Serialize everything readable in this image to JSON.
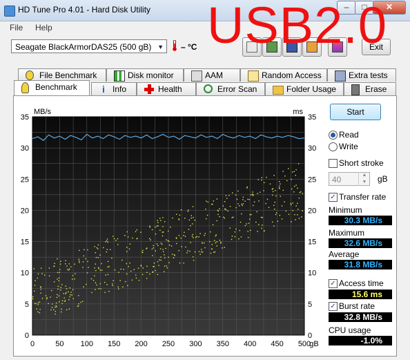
{
  "window": {
    "title": "HD Tune Pro 4.01 - Hard Disk Utility",
    "exit_label": "Exit"
  },
  "watermark": "USB2.0",
  "menu": [
    {
      "label": "File"
    },
    {
      "label": "Help"
    }
  ],
  "toolbar": {
    "drive": "Seagate BlackArmorDAS25  (500 gB)",
    "temperature": "– °C"
  },
  "tabs_top": [
    {
      "label": "File Benchmark",
      "icon": "file-benchmark-icon"
    },
    {
      "label": "Disk monitor",
      "icon": "disk-monitor-icon"
    },
    {
      "label": "AAM",
      "icon": "speaker-icon"
    },
    {
      "label": "Random Access",
      "icon": "random-access-icon"
    },
    {
      "label": "Extra tests",
      "icon": "extra-tests-icon"
    }
  ],
  "tabs_bottom": [
    {
      "label": "Benchmark",
      "icon": "benchmark-icon",
      "active": true
    },
    {
      "label": "Info",
      "icon": "info-icon"
    },
    {
      "label": "Health",
      "icon": "health-icon"
    },
    {
      "label": "Error Scan",
      "icon": "magnifier-icon"
    },
    {
      "label": "Folder Usage",
      "icon": "folder-icon"
    },
    {
      "label": "Erase",
      "icon": "trash-icon"
    }
  ],
  "controls": {
    "start_label": "Start",
    "read_label": "Read",
    "write_label": "Write",
    "mode_selected": "Read",
    "short_stroke_label": "Short stroke",
    "short_stroke_checked": false,
    "short_stroke_value": "40",
    "short_stroke_unit": "gB",
    "transfer_rate_label": "Transfer rate",
    "transfer_rate_checked": true,
    "access_time_label": "Access time",
    "access_time_checked": true,
    "burst_rate_label": "Burst rate",
    "burst_rate_checked": true
  },
  "stats": {
    "minimum_label": "Minimum",
    "minimum": "30.3 MB/s",
    "maximum_label": "Maximum",
    "maximum": "32.6 MB/s",
    "average_label": "Average",
    "average": "31.8 MB/s",
    "access_time": "15.6 ms",
    "burst_rate": "32.8 MB/s",
    "cpu_label": "CPU usage",
    "cpu_usage": "-1.0%"
  },
  "chart_data": {
    "type": "line",
    "ylabel_left": "MB/s",
    "ylabel_right": "ms",
    "xunit": "gB",
    "xlim": [
      0,
      500
    ],
    "ylim": [
      0,
      35
    ],
    "x_ticks": [
      "0",
      "50",
      "100",
      "150",
      "200",
      "250",
      "300",
      "350",
      "400",
      "450",
      "500"
    ],
    "y_ticks": [
      "0",
      "5",
      "10",
      "15",
      "20",
      "25",
      "30",
      "35"
    ],
    "grid": true,
    "series": [
      {
        "color": "#5aa9e6",
        "x": [
          0,
          10,
          20,
          30,
          40,
          50,
          60,
          70,
          80,
          90,
          100,
          110,
          120,
          130,
          140,
          150,
          160,
          170,
          180,
          190,
          200,
          210,
          220,
          230,
          240,
          250,
          260,
          270,
          280,
          290,
          300,
          310,
          320,
          330,
          340,
          350,
          360,
          370,
          380,
          390,
          400,
          410,
          420,
          430,
          440,
          450,
          460,
          470,
          480,
          490,
          500
        ],
        "y": [
          31.5,
          31.8,
          31.2,
          32.1,
          31.6,
          31.9,
          31.4,
          32.0,
          31.7,
          31.3,
          32.2,
          31.6,
          31.9,
          31.5,
          32.1,
          31.8,
          31.4,
          32.0,
          31.7,
          31.9,
          31.6,
          32.1,
          31.5,
          31.8,
          32.2,
          31.7,
          31.9,
          31.4,
          32.0,
          31.8,
          31.6,
          32.1,
          31.7,
          31.9,
          31.5,
          32.2,
          31.8,
          31.6,
          32.0,
          31.7,
          31.9,
          31.5,
          32.1,
          31.8,
          31.6,
          31.9,
          31.7,
          32.0,
          31.8,
          31.5,
          31.6
        ]
      }
    ],
    "access_time_points": {
      "color": "#e8e84a",
      "description_min_ms": 5,
      "description_max_ms": 28
    }
  }
}
